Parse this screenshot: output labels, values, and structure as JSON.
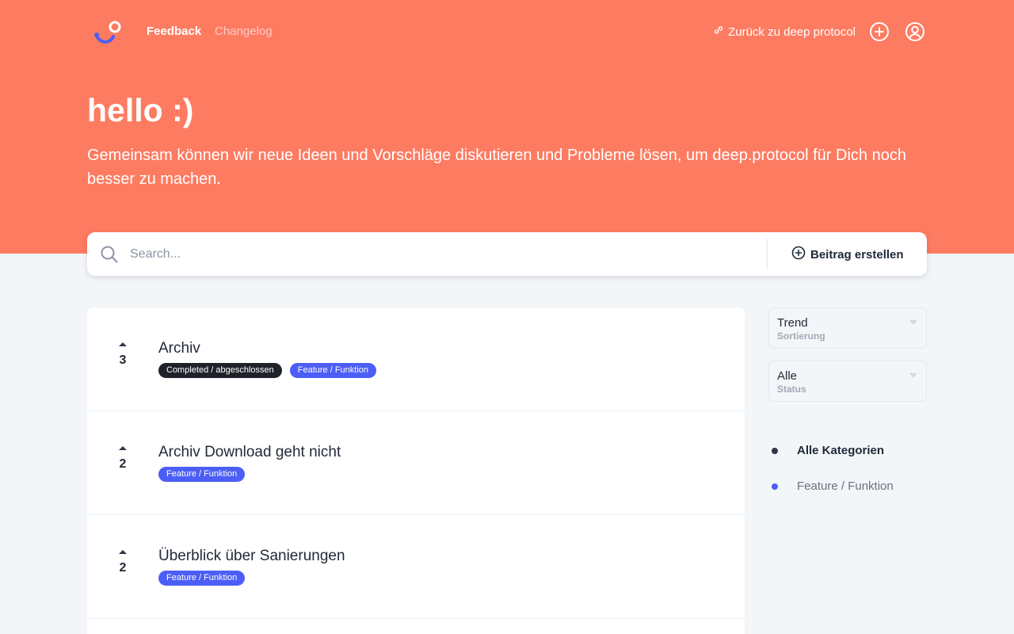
{
  "nav": {
    "logo_icon": "brand-logo-icon",
    "feedback_label": "Feedback",
    "changelog_label": "Changelog",
    "back_link_label": "Zurück zu deep protocol",
    "link_icon": "link-icon",
    "add_icon": "plus-circle-icon",
    "account_icon": "user-circle-icon"
  },
  "hero": {
    "title": "hello :)",
    "subtitle": "Gemeinsam können wir neue Ideen und Vorschläge diskutieren und Probleme lösen, um deep.protocol für Dich noch besser zu machen.",
    "background_color": "#fd7b61"
  },
  "search": {
    "placeholder": "Search...",
    "value": "",
    "create_label": "Beitrag erstellen"
  },
  "posts": [
    {
      "title": "Archiv",
      "votes": "3",
      "tags": [
        {
          "label": "Completed / abgeschlossen",
          "color": "#1f2229"
        },
        {
          "label": "Feature / Funktion",
          "color": "#4c5ef6"
        }
      ]
    },
    {
      "title": "Archiv Download geht nicht",
      "votes": "2",
      "tags": [
        {
          "label": "Feature / Funktion",
          "color": "#4c5ef6"
        }
      ]
    },
    {
      "title": "Überblick über Sanierungen",
      "votes": "2",
      "tags": [
        {
          "label": "Feature / Funktion",
          "color": "#4c5ef6"
        }
      ]
    }
  ],
  "filters": {
    "sort": {
      "value": "Trend",
      "label": "Sortierung"
    },
    "status": {
      "value": "Alle",
      "label": "Status"
    }
  },
  "categories": [
    {
      "label": "Alle Kategorien",
      "color": "#2d3748",
      "active": true
    },
    {
      "label": "Feature / Funktion",
      "color": "#4c5ef6",
      "active": false
    }
  ]
}
